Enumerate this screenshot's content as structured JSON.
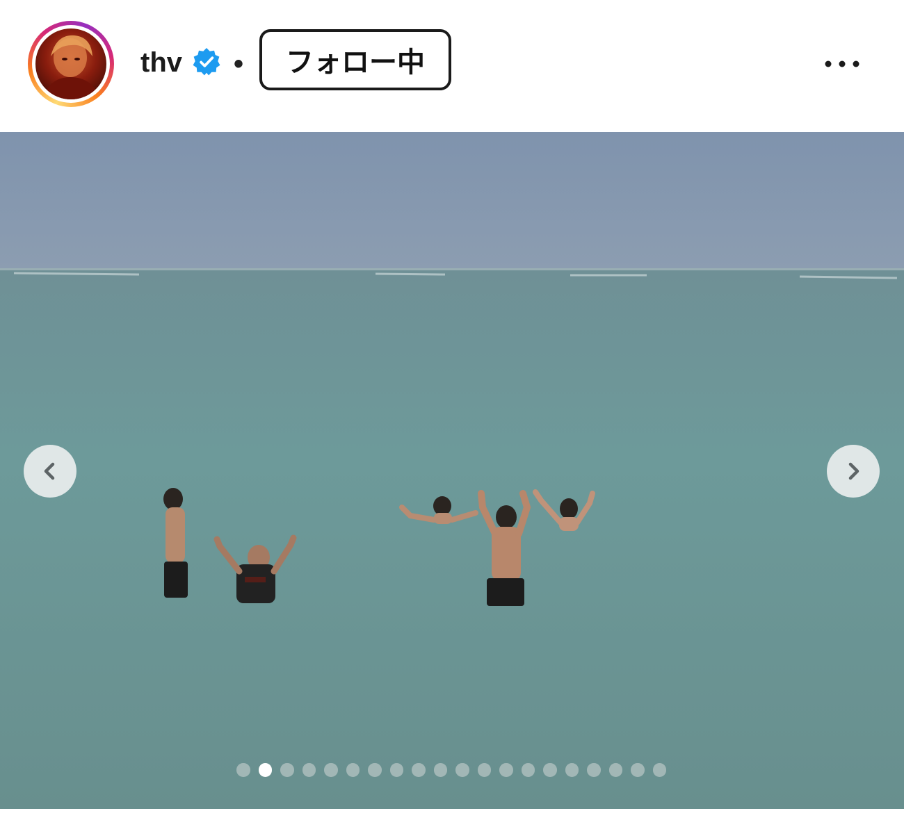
{
  "post": {
    "username": "thv",
    "separator": "•",
    "follow_label": "フォロー中",
    "verified": true,
    "ring_colors": [
      "#feda75",
      "#fa7e1e",
      "#d62976",
      "#962fbf"
    ]
  },
  "carousel": {
    "slide_count": 20,
    "active_index": 1
  },
  "icons": {
    "avatar": "profile-avatar",
    "verified": "verified-badge-icon",
    "more": "more-options-icon",
    "prev": "chevron-left-icon",
    "next": "chevron-right-icon"
  },
  "colors": {
    "verified_blue": "#1d9bf0",
    "text": "#1b1b1b"
  }
}
